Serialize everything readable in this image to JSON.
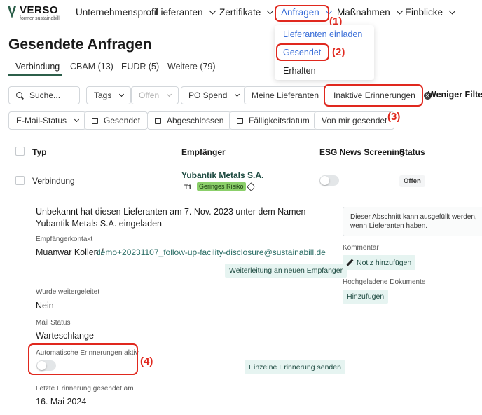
{
  "logo": {
    "name": "VERSO",
    "sub": "former sustainabill"
  },
  "nav": {
    "items": [
      {
        "label": "Unternehmensprofil"
      },
      {
        "label": "Lieferanten"
      },
      {
        "label": "Zertifikate"
      },
      {
        "label": "Anfragen"
      },
      {
        "label": "Maßnahmen"
      },
      {
        "label": "Einblicke"
      }
    ],
    "active": "Anfragen"
  },
  "dropdown": {
    "items": [
      "Lieferanten einladen",
      "Gesendet",
      "Erhalten"
    ],
    "selected": "Gesendet"
  },
  "annotations": {
    "a1": "(1)",
    "a2": "(2)",
    "a3": "(3)",
    "a4": "(4)"
  },
  "colors": {
    "accent": "#3b6fd8",
    "annotation": "#e0281e",
    "brand_green": "#2c5f4a",
    "risk_green": "#8bcf6a"
  },
  "page": {
    "title": "Gesendete Anfragen"
  },
  "tabs": [
    "Verbindung",
    "CBAM (13)",
    "EUDR (5)",
    "Weitere (79)"
  ],
  "filters": {
    "search_placeholder": "Suche...",
    "tags": "Tags",
    "offen": "Offen",
    "po_spend": "PO Spend",
    "meine_lieferanten": "Meine Lieferanten",
    "inaktive": "Inaktive Erinnerungen",
    "less": "Weniger Filter",
    "email_status": "E-Mail-Status",
    "gesendet": "Gesendet",
    "abgeschlossen": "Abgeschlossen",
    "faelligkeit": "Fälligkeitsdatum",
    "von_mir": "Von mir gesendet"
  },
  "table": {
    "headers": [
      "Typ",
      "Empfänger",
      "ESG News Screening",
      "Status"
    ],
    "row": {
      "typ": "Verbindung",
      "recipient": "Yubantik Metals S.A.",
      "tier": "T1",
      "risk": "Geringes Risiko",
      "esg_toggle": false,
      "status": "Offen"
    }
  },
  "detail": {
    "invite_text": "Unbekannt hat diesen Lieferanten am 7. Nov. 2023 unter dem Namen Yubantik Metals S.A. eingeladen",
    "contact_label": "Empfängerkontakt",
    "contact_name": "Muanwar Kollen /",
    "contact_email": "demo+20231107_follow-up-facility-disclosure@sustainabill.de",
    "forward_button": "Weiterleitung an neuen Empfänger",
    "forwarded_label": "Wurde weitergeleitet",
    "forwarded_value": "Nein",
    "mail_status_label": "Mail Status",
    "mail_status_value": "Warteschlange",
    "auto_reminder_label": "Automatische Erinnerungen aktiv",
    "auto_reminder": false,
    "single_reminder_button": "Einzelne Erinnerung senden",
    "last_reminder_label": "Letzte Erinnerung gesendet am",
    "last_reminder_value": "16. Mai 2024",
    "info_box": "Dieser Abschnitt kann ausgefüllt werden, wenn Lieferanten haben.",
    "comment_label": "Kommentar",
    "add_note": "Notiz hinzufügen",
    "docs_label": "Hochgeladene Dokumente",
    "add_button": "Hinzufügen"
  }
}
